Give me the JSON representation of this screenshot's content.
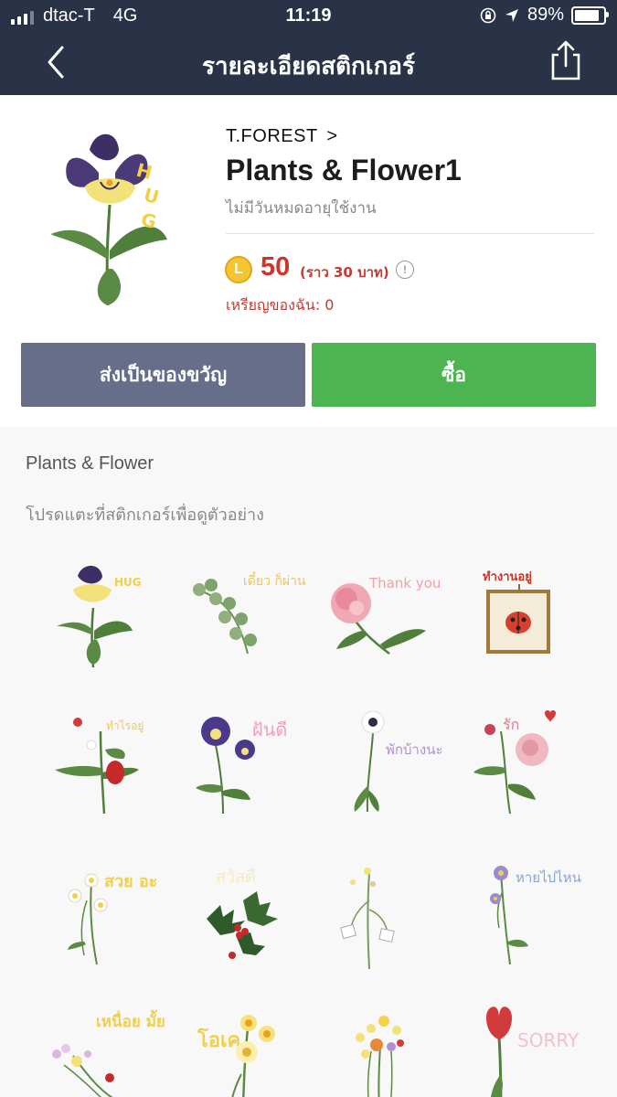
{
  "status_bar": {
    "carrier": "dtac-T",
    "network": "4G",
    "time": "11:19",
    "battery": "89%"
  },
  "nav": {
    "title": "รายละเอียดสติกเกอร์"
  },
  "sticker_pack": {
    "author": "T.FOREST",
    "author_chevron": ">",
    "title": "Plants & Flower1",
    "expiry": "ไม่มีวันหมดอายุใช้งาน",
    "coin_symbol": "L",
    "price": "50",
    "price_approx": "(ราว  30 บาท)",
    "info_symbol": "!",
    "my_coins": "เหรียญของฉัน: 0"
  },
  "buttons": {
    "gift": "ส่งเป็นของขวัญ",
    "buy": "ซื้อ"
  },
  "section": {
    "title": "Plants & Flower",
    "hint": "โปรดแตะที่สติกเกอร์เพื่อดูตัวอย่าง"
  },
  "stickers": [
    {
      "caption": "HUG"
    },
    {
      "caption": "เดี๋ยว ก็ผ่าน ไป"
    },
    {
      "caption": "Thank you"
    },
    {
      "caption": "ทำงานอยู่"
    },
    {
      "caption": "ทำไรอยู่"
    },
    {
      "caption": "ฝันดี"
    },
    {
      "caption": "พักบ้างนะ"
    },
    {
      "caption": "รัก"
    },
    {
      "caption": "สวย อะ"
    },
    {
      "caption": "สวัสดี"
    },
    {
      "caption": ""
    },
    {
      "caption": "หายไปไหน"
    },
    {
      "caption": "เหนื่อย มั้ย"
    },
    {
      "caption": "โอเค"
    },
    {
      "caption": ""
    },
    {
      "caption": "SORRY"
    }
  ],
  "colors": {
    "nav_bg": "#2a3248",
    "gift_button": "#666e8a",
    "buy_button": "#4cb551",
    "price": "#d2342b"
  }
}
